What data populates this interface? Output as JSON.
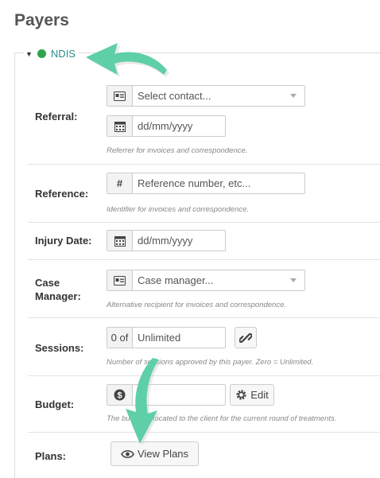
{
  "page": {
    "title": "Payers"
  },
  "payer": {
    "name": "NDIS",
    "status_color": "#2ea44f"
  },
  "fields": {
    "referral": {
      "label": "Referral:",
      "contact_placeholder": "Select contact...",
      "date_placeholder": "dd/mm/yyyy",
      "help": "Referrer for invoices and correspondence."
    },
    "reference": {
      "label": "Reference:",
      "placeholder": "Reference number, etc...",
      "help": "Identifier for invoices and correspondence."
    },
    "injury_date": {
      "label": "Injury Date:",
      "placeholder": "dd/mm/yyyy"
    },
    "case_manager": {
      "label_line1": "Case",
      "label_line2": "Manager:",
      "placeholder": "Case manager...",
      "help": "Alternative recipient for invoices and correspondence."
    },
    "sessions": {
      "label": "Sessions:",
      "prefix": "0 of",
      "placeholder": "Unlimited",
      "help": "Number of sessions approved by this payer. Zero = Unlimited."
    },
    "budget": {
      "label": "Budget:",
      "edit_label": "Edit",
      "help": "The budget allocated to the client for the current round of treatments."
    },
    "plans": {
      "label": "Plans:",
      "button_label": "View Plans"
    }
  },
  "icons": {
    "contact": "contact-card-icon",
    "calendar": "calendar-icon",
    "hash": "hash-icon",
    "case_manager": "id-card-icon",
    "link": "link-icon",
    "dollar": "dollar-icon",
    "gear": "gear-icon",
    "eye": "eye-icon"
  }
}
